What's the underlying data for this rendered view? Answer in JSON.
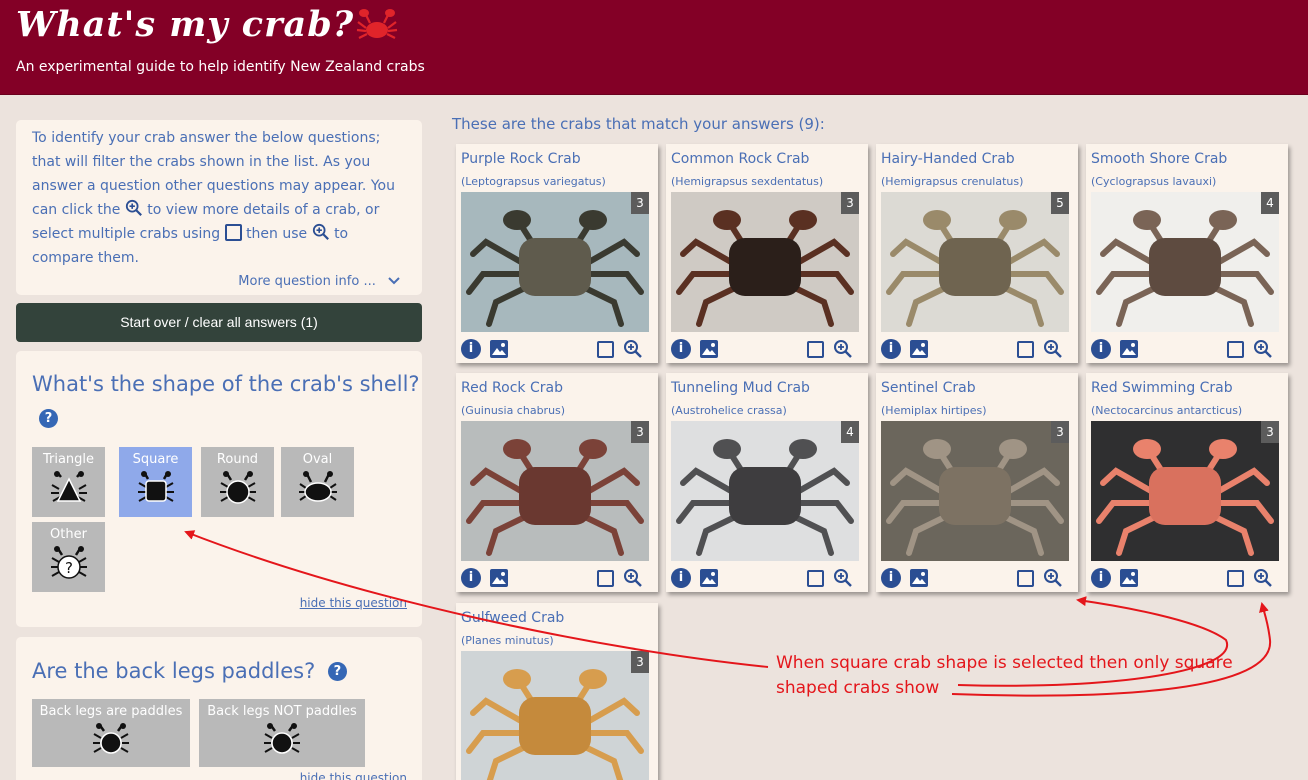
{
  "header": {
    "title": "What's my crab?",
    "subtitle": "An experimental guide to help identify New Zealand crabs"
  },
  "intro": {
    "part1": "To identify your crab answer the below questions; that will filter the crabs shown in the list. As you answer a question other questions may appear. You can click the",
    "part2": "to view more details of a crab, or select multiple crabs using",
    "part3": "then use",
    "part4": "to compare them.",
    "more_info": "More question info ..."
  },
  "start_over_label": "Start over / clear all answers (1)",
  "question_shape": {
    "title": "What's the shape of the crab's shell?",
    "help": "?",
    "options": [
      {
        "label": "Triangle",
        "selected": false
      },
      {
        "label": "Square",
        "selected": true
      },
      {
        "label": "Round",
        "selected": false
      },
      {
        "label": "Oval",
        "selected": false
      },
      {
        "label": "Other",
        "selected": false
      }
    ],
    "hide_label": "hide this question"
  },
  "question_legs": {
    "title": "Are the back legs paddles?",
    "help": "?",
    "options": [
      {
        "label": "Back legs are paddles"
      },
      {
        "label": "Back legs NOT paddles"
      }
    ],
    "hide_label": "hide this question"
  },
  "results": {
    "heading": "These are the crabs that match your answers (9):",
    "crabs": [
      {
        "name": "Purple Rock Crab",
        "scientific": "(Leptograpsus variegatus)",
        "photo_count": "3",
        "colors": [
          "#a7b8bd",
          "#5f5b4d",
          "#3a3a30"
        ]
      },
      {
        "name": "Common Rock Crab",
        "scientific": "(Hemigrapsus sexdentatus)",
        "photo_count": "3",
        "colors": [
          "#cfcac4",
          "#2b1f1a",
          "#5a3022"
        ]
      },
      {
        "name": "Hairy-Handed Crab",
        "scientific": "(Hemigrapsus crenulatus)",
        "photo_count": "5",
        "colors": [
          "#dcdad4",
          "#6f6450",
          "#9a8a6a"
        ]
      },
      {
        "name": "Smooth Shore Crab",
        "scientific": "(Cyclograpsus lavauxi)",
        "photo_count": "4",
        "colors": [
          "#f0efec",
          "#5e4b40",
          "#7a6456"
        ]
      },
      {
        "name": "Red Rock Crab",
        "scientific": "(Guinusia chabrus)",
        "photo_count": "3",
        "colors": [
          "#b8bcbc",
          "#6a3830",
          "#7b4238"
        ]
      },
      {
        "name": "Tunneling Mud Crab",
        "scientific": "(Austrohelice crassa)",
        "photo_count": "4",
        "colors": [
          "#dedfe0",
          "#3e3d3f",
          "#505052"
        ]
      },
      {
        "name": "Sentinel Crab",
        "scientific": "(Hemiplax hirtipes)",
        "photo_count": "3",
        "colors": [
          "#6b665c",
          "#7d7263",
          "#a09485"
        ]
      },
      {
        "name": "Red Swimming Crab",
        "scientific": "(Nectocarcinus antarcticus)",
        "photo_count": "3",
        "colors": [
          "#2f2f30",
          "#d9715e",
          "#e9826c"
        ]
      },
      {
        "name": "Gulfweed Crab",
        "scientific": "(Planes minutus)",
        "photo_count": "3",
        "colors": [
          "#cfd4d6",
          "#c58a3c",
          "#d79d4e"
        ]
      }
    ]
  },
  "annotation": {
    "line1": "When square crab shape is selected then only square",
    "line2": "shaped crabs show"
  },
  "colors": {
    "header_bg": "#830026",
    "accent_text": "#4a6fb5",
    "selected_option": "#8fa9ea",
    "annotation_red": "#e4161b"
  }
}
